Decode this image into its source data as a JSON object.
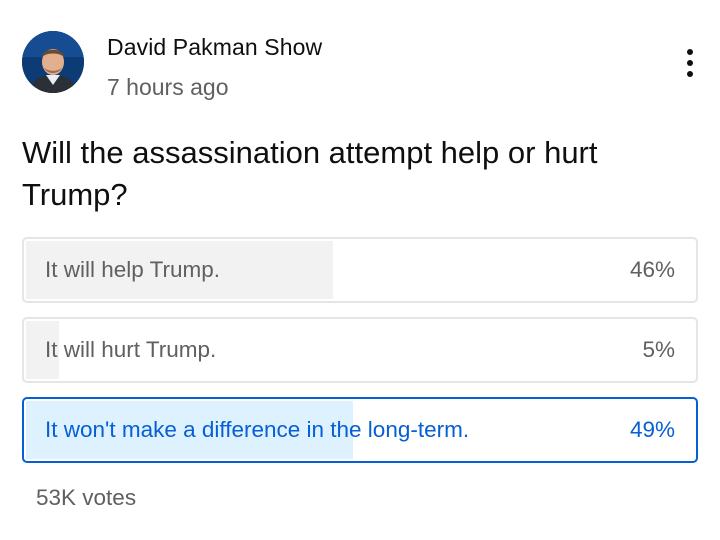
{
  "post": {
    "channel_name": "David Pakman Show",
    "time": "7 hours ago",
    "menu_icon": "more-vertical-icon",
    "avatar": "channel-avatar-photo"
  },
  "poll": {
    "question": "Will the assassination attempt help or hurt Trump?",
    "options": [
      {
        "label": "It will help Trump.",
        "percent_text": "46%",
        "percent": 46,
        "selected": false
      },
      {
        "label": "It will hurt Trump.",
        "percent_text": "5%",
        "percent": 5,
        "selected": false
      },
      {
        "label": "It won't make a difference in the long-term.",
        "percent_text": "49%",
        "percent": 49,
        "selected": true
      }
    ],
    "votes": "53K votes"
  },
  "colors": {
    "accent": "#065fd4",
    "selected_fill": "#def1ff",
    "result_fill": "#f2f2f2",
    "border": "#e5e5e5",
    "secondary_text": "#606060"
  }
}
